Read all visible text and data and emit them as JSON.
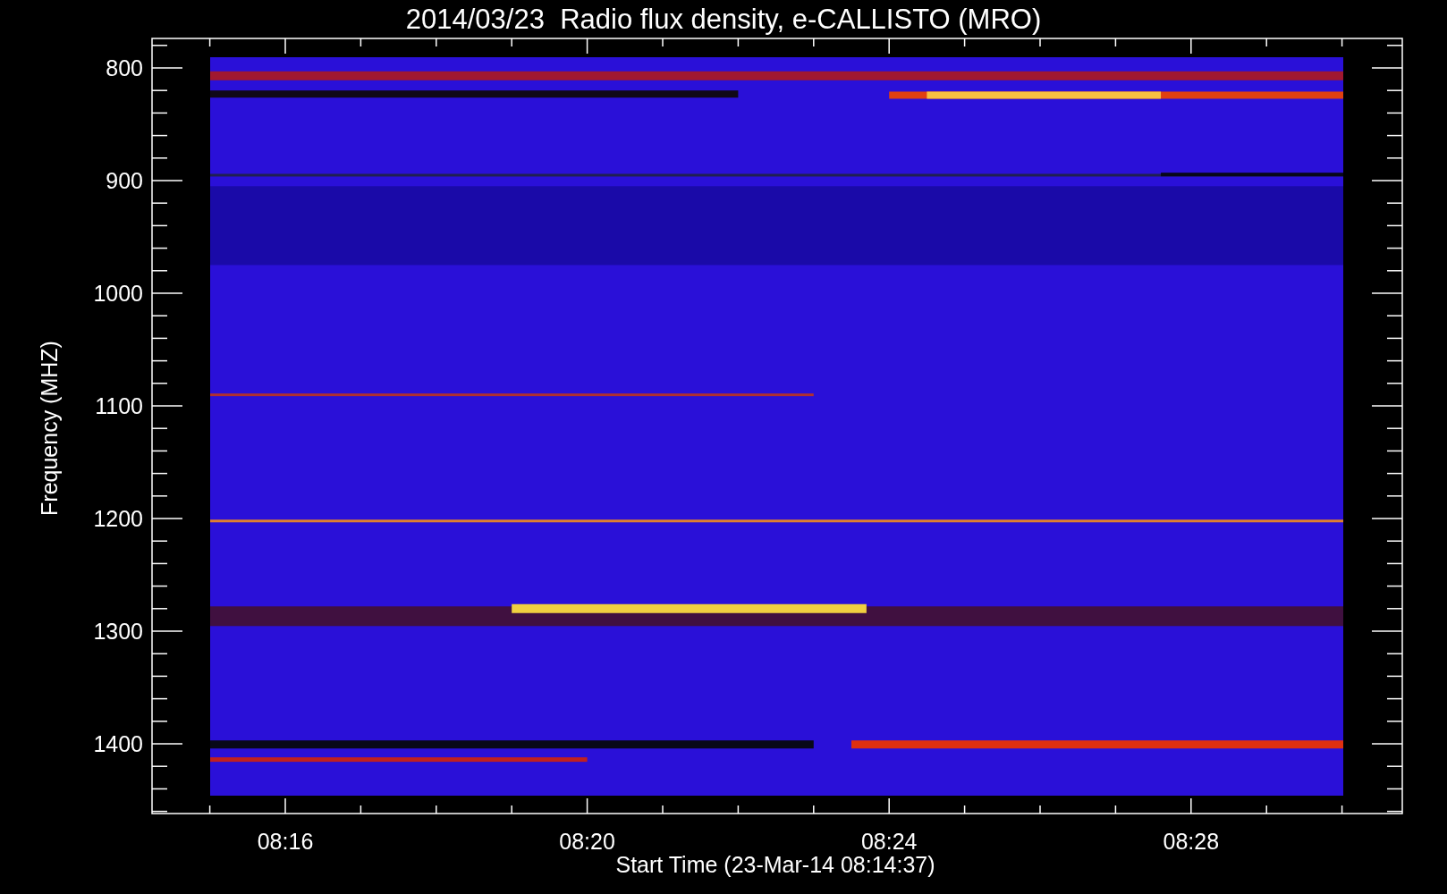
{
  "title": "2014/03/23  Radio flux density, e-CALLISTO (MRO)",
  "y_axis": {
    "label": "Frequency (MHZ)",
    "ticks": [
      "800",
      "900",
      "1000",
      "1100",
      "1200",
      "1300",
      "1400"
    ]
  },
  "x_axis": {
    "label": "Start Time (23-Mar-14 08:14:37)",
    "ticks": [
      "08:16",
      "08:20",
      "08:24",
      "08:28"
    ]
  }
}
